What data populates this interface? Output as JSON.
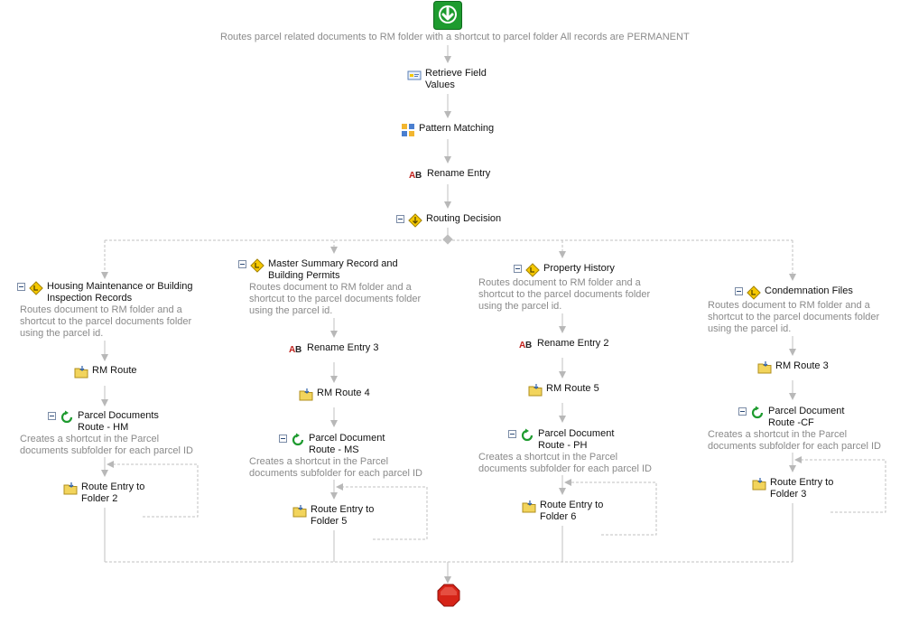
{
  "workflow": {
    "description": "Routes parcel related documents to RM folder with a shortcut to parcel folder  All records are PERMANENT",
    "steps": {
      "retrieve": "Retrieve Field Values",
      "pattern": "Pattern Matching",
      "rename": "Rename Entry",
      "decision": "Routing Decision"
    }
  },
  "branches": [
    {
      "title": "Housing Maintenance or Building Inspection Records",
      "description": "Routes document to RM folder and a shortcut to the parcel documents folder using the parcel id.",
      "rm_route": "RM Route",
      "shortcut_route": "Parcel Documents Route - HM",
      "shortcut_description": "Creates a shortcut in the Parcel documents subfolder for each parcel ID",
      "route_entry": "Route Entry to Folder 2"
    },
    {
      "title": "Master Summary Record and Building Permits",
      "description": "Routes document to RM folder and a shortcut to the parcel documents folder using the parcel id.",
      "rename": "Rename Entry 3",
      "rm_route": "RM Route 4",
      "shortcut_route": "Parcel Document Route - MS",
      "shortcut_description": "Creates a shortcut in the Parcel documents subfolder for each parcel ID",
      "route_entry": "Route Entry to Folder 5"
    },
    {
      "title": "Property History",
      "description": "Routes document to RM folder and a shortcut to the parcel documents folder using the parcel id.",
      "rename": "Rename Entry 2",
      "rm_route": "RM Route 5",
      "shortcut_route": "Parcel Document Route - PH",
      "shortcut_description": "Creates a shortcut in the Parcel documents subfolder for each parcel ID",
      "route_entry": "Route Entry to Folder 6"
    },
    {
      "title": "Condemnation Files",
      "description": "Routes document to RM folder and a shortcut to the parcel documents folder using the parcel id.",
      "rm_route": "RM Route 3",
      "shortcut_route": "Parcel Document Route -CF",
      "shortcut_description": "Creates a shortcut in the Parcel documents subfolder for each parcel ID",
      "route_entry": "Route Entry to Folder 3"
    }
  ],
  "colors": {
    "start": "#1e9b2f",
    "stop": "#d62418",
    "arrow": "#b8b8b8",
    "decision": "#f5c800",
    "folder": "#f2d45c"
  }
}
